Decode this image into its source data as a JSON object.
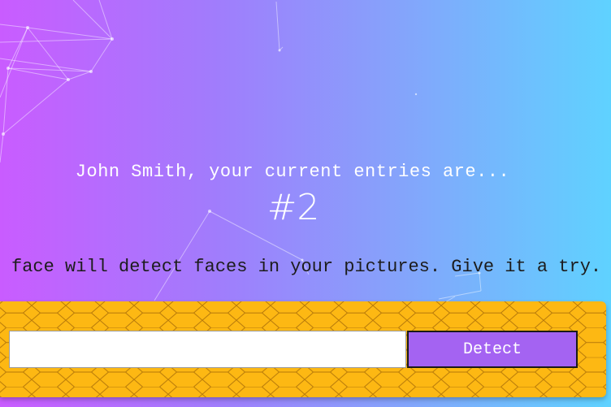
{
  "rank_section": {
    "entries_text": "John Smith, your current entries are...",
    "rank": "#2"
  },
  "description": "face will detect faces in your pictures. Give it a try.",
  "form": {
    "url_input_value": "",
    "detect_label": "Detect"
  },
  "colors": {
    "gradient_left": "#c95cff",
    "gradient_right": "#5fd2ff",
    "panel_background": "#fdb813",
    "button_background": "#a463f2"
  }
}
